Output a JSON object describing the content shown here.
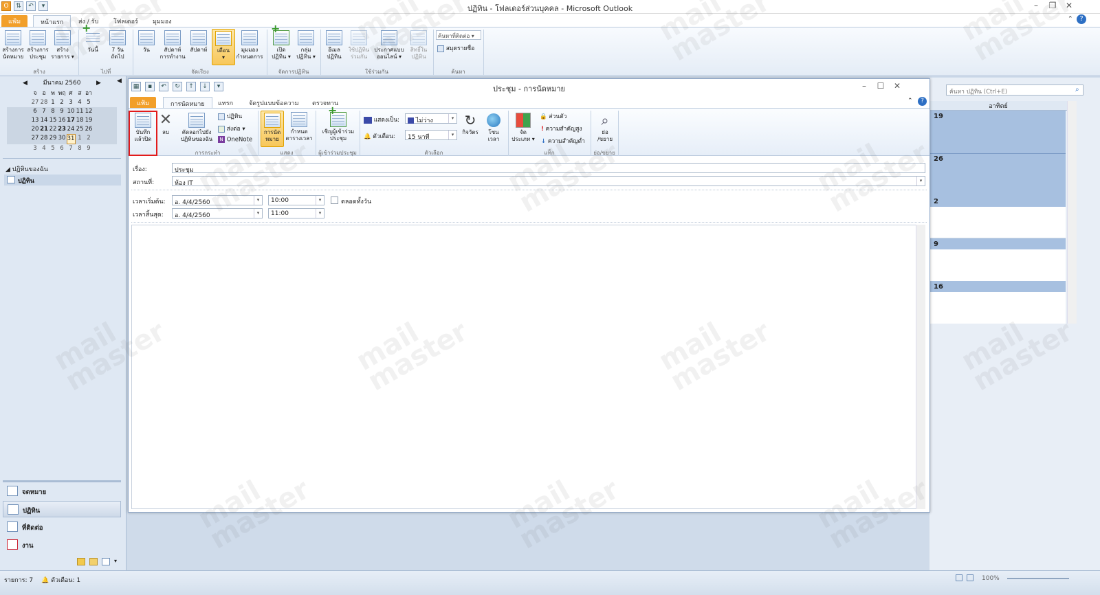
{
  "app": {
    "title": "ปฏิทิน - โฟลเดอร์ส่วนบุคคล - Microsoft Outlook"
  },
  "main_tabs": {
    "file": "แฟ้ม",
    "home": "หน้าแรก",
    "send": "ส่ง / รับ",
    "folder": "โฟลเดอร์",
    "view": "มุมมอง"
  },
  "ribbon": {
    "new_appt": "สร้างการ\nนัดหมาย",
    "new_meeting": "สร้างการ\nประชุม",
    "new_items": "สร้าง\nรายการ ▾",
    "today": "วันนี้",
    "next7": "7 วัน\nถัดไป",
    "day": "วัน",
    "work_week": "สัปดาห์\nการทำงาน",
    "week": "สัปดาห์",
    "month": "เดือน\n▾",
    "schedule": "มุมมอง\nกำหนดการ",
    "open_cal": "เปิด\nปฏิทิน ▾",
    "cal_groups": "กลุ่ม\nปฏิทิน ▾",
    "email_cal": "อีเมล\nปฏิทิน",
    "share_cal": "ใช้ปฏิทิน\nร่วมกัน",
    "publish": "ประกาศแบบ\nออนไลน์ ▾",
    "perm": "สิทธิ์ใน\nปฏิทิน",
    "find_contact": "ค้นหาที่ติดต่อ ▾",
    "address_book": "สมุดรายชื่อ",
    "grp_new": "สร้าง",
    "grp_goto": "ไปที่",
    "grp_arrange": "จัดเรียง",
    "grp_manage": "จัดการปฏิทิน",
    "grp_share": "ใช้ร่วมกัน",
    "grp_find": "ค้นหา"
  },
  "mini_calendar": {
    "title": "มีนาคม 2560",
    "days": [
      "จ",
      "อ",
      "พ",
      "พฤ",
      "ศ",
      "ส",
      "อา"
    ],
    "weeks": [
      [
        "27",
        "28",
        "1",
        "2",
        "3",
        "4",
        "5"
      ],
      [
        "6",
        "7",
        "8",
        "9",
        "10",
        "11",
        "12"
      ],
      [
        "13",
        "14",
        "15",
        "16",
        "17",
        "18",
        "19"
      ],
      [
        "20",
        "21",
        "22",
        "23",
        "24",
        "25",
        "26"
      ],
      [
        "27",
        "28",
        "29",
        "30",
        "31",
        "1",
        "2"
      ],
      [
        "3",
        "4",
        "5",
        "6",
        "7",
        "8",
        "9"
      ]
    ]
  },
  "nav_tree": {
    "my_calendars": "ปฏิทินของฉัน",
    "calendar": "ปฏิทิน"
  },
  "nav_buttons": {
    "mail": "จดหมาย",
    "calendar": "ปฏิทิน",
    "contacts": "ที่ติดต่อ",
    "tasks": "งาน"
  },
  "right_pane": {
    "search_placeholder": "ค้นหา ปฏิทิน (Ctrl+E)",
    "sunday": "อาทิตย์",
    "weeks": [
      "19",
      "26",
      "2",
      "9",
      "16"
    ]
  },
  "status": {
    "items": "รายการ: 7",
    "reminders": "ตัวเตือน: 1",
    "zoom": "100%"
  },
  "dialog": {
    "title": "ประชุม - การนัดหมาย",
    "tabs": {
      "file": "แฟ้ม",
      "appointment": "การนัดหมาย",
      "insert": "แทรก",
      "format": "จัดรูปแบบข้อความ",
      "review": "ตรวจทาน"
    },
    "ribbon": {
      "save_close": "บันทึก\nแล้วปิด",
      "delete": "ลบ",
      "copy_to": "คัดลอกไปยัง\nปฏิทินของฉัน",
      "calendar": "ปฏิทิน",
      "forward": "ส่งต่อ ▾",
      "onenote": "OneNote",
      "appointment": "การนัด\nหมาย",
      "scheduling": "กำหนด\nตารางเวลา",
      "invite": "เชิญผู้เข้าร่วม\nประชุม",
      "show_as_label": "แสดงเป็น:",
      "show_as_value": "ไม่ว่าง",
      "reminder_label": "ตัวเตือน:",
      "reminder_value": "15 นาที",
      "recurrence": "กิจวัตร",
      "timezones": "โซน\nเวลา",
      "categorize": "จัด\nประเภท ▾",
      "private": "ส่วนตัว",
      "high": "ความสำคัญสูง",
      "low": "ความสำคัญต่ำ",
      "zoom": "ย่อ\n/ขยาย",
      "grp_actions": "การกระทำ",
      "grp_show": "แสดง",
      "grp_attendees": "ผู้เข้าร่วมประชุม",
      "grp_options": "ตัวเลือก",
      "grp_tags": "แท็ก",
      "grp_zoom": "ย่อ/ขยาย"
    },
    "form": {
      "subject_label": "เรื่อง:",
      "subject_value": "ประชุม",
      "location_label": "สถานที่:",
      "location_value": "ห้อง IT",
      "start_label": "เวลาเริ่มต้น:",
      "start_date": "อ. 4/4/2560",
      "start_time": "10:00",
      "allday_label": "ตลอดทั้งวัน",
      "end_label": "เวลาสิ้นสุด:",
      "end_date": "อ. 4/4/2560",
      "end_time": "11:00"
    }
  },
  "watermark": {
    "line1": "mail",
    "line2": "master"
  }
}
